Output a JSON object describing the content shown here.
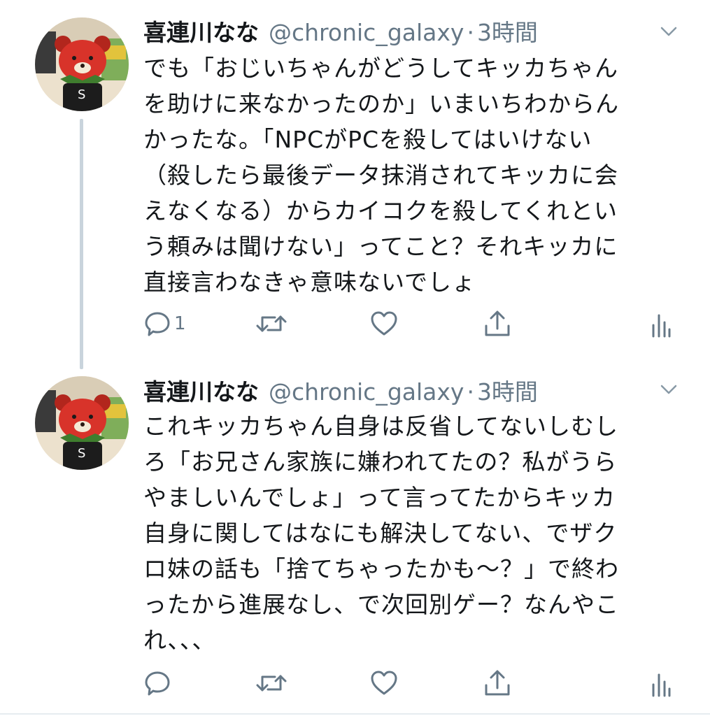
{
  "tweets": [
    {
      "name": "喜連川なな",
      "handle": "@chronic_galaxy",
      "separator": "·",
      "time": "3時間",
      "text": "でも「おじいちゃんがどうしてキッカちゃん\nを助けに来なかったのか」いまいちわからん\nかったな。「NPCがPCを殺してはいけない\n（殺したら最後データ抹消されてキッカに会\nえなくなる）からカイコクを殺してくれとい\nう頼みは聞けない」ってこと？それキッカに\n直接言わなきゃ意味ないでしょ",
      "reply_count": "1",
      "avatar_label": "S"
    },
    {
      "name": "喜連川なな",
      "handle": "@chronic_galaxy",
      "separator": "·",
      "time": "3時間",
      "text": "これキッカちゃん自身は反省してないしむし\nろ「お兄さん家族に嫌われてたの？私がうら\nやましいんでしょ」って言ってたからキッカ\n自身に関してはなにも解決してない、でザク\nロ妹の話も「捨てちゃったかも〜？」で終わ\nったから進展なし、で次回別ゲー？なんやこ\nれ、、、",
      "reply_count": "",
      "avatar_label": "S"
    }
  ],
  "icons": [
    "reply-icon",
    "retweet-icon",
    "like-icon",
    "share-icon",
    "analytics-icon",
    "chevron-down-icon"
  ],
  "colors": {
    "text": "#14171a",
    "muted": "#657786",
    "thread_line": "#c9d4dc"
  }
}
